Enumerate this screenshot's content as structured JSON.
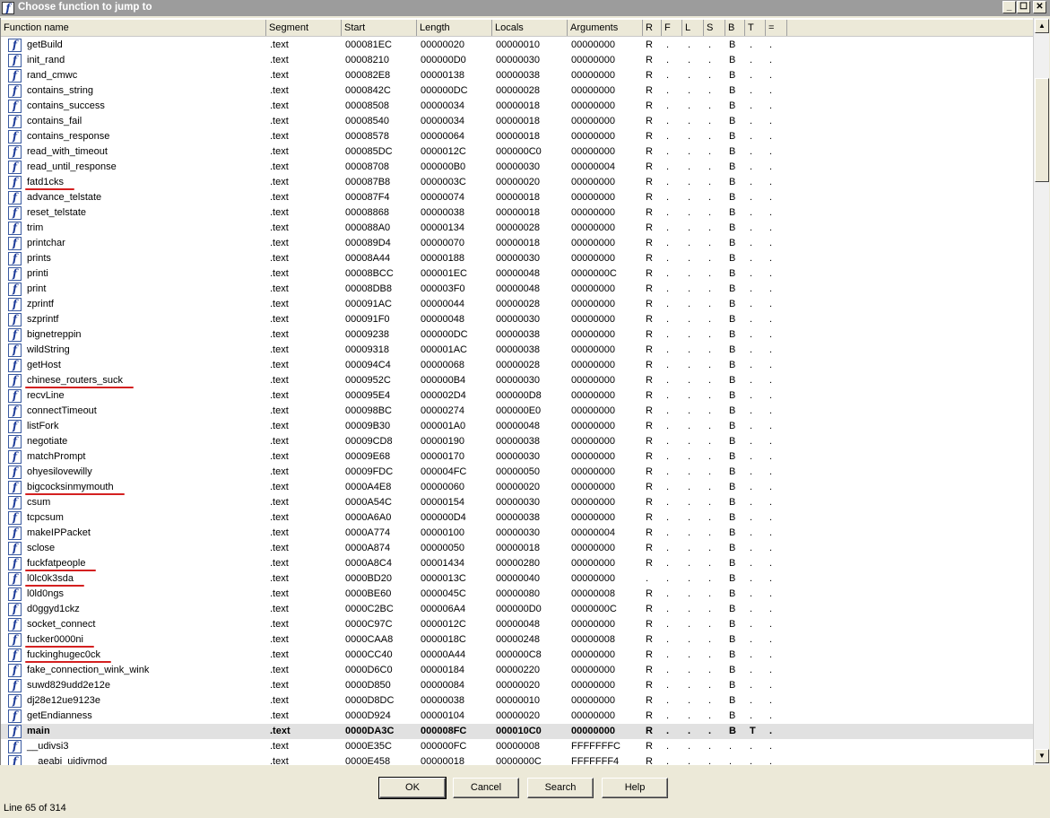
{
  "window": {
    "title": "Choose function to jump to",
    "icon": "function-icon",
    "controls": [
      "_",
      "☐",
      "✕"
    ]
  },
  "columns": [
    "Function name",
    "Segment",
    "Start",
    "Length",
    "Locals",
    "Arguments",
    "R",
    "F",
    "L",
    "S",
    "B",
    "T",
    "="
  ],
  "rows": [
    [
      "getBuild",
      ".text",
      "000081EC",
      "00000020",
      "00000010",
      "00000000",
      "R",
      ".",
      ".",
      ".",
      "B",
      ".",
      "."
    ],
    [
      "init_rand",
      ".text",
      "00008210",
      "000000D0",
      "00000030",
      "00000000",
      "R",
      ".",
      ".",
      ".",
      "B",
      ".",
      "."
    ],
    [
      "rand_cmwc",
      ".text",
      "000082E8",
      "00000138",
      "00000038",
      "00000000",
      "R",
      ".",
      ".",
      ".",
      "B",
      ".",
      "."
    ],
    [
      "contains_string",
      ".text",
      "0000842C",
      "000000DC",
      "00000028",
      "00000000",
      "R",
      ".",
      ".",
      ".",
      "B",
      ".",
      "."
    ],
    [
      "contains_success",
      ".text",
      "00008508",
      "00000034",
      "00000018",
      "00000000",
      "R",
      ".",
      ".",
      ".",
      "B",
      ".",
      "."
    ],
    [
      "contains_fail",
      ".text",
      "00008540",
      "00000034",
      "00000018",
      "00000000",
      "R",
      ".",
      ".",
      ".",
      "B",
      ".",
      "."
    ],
    [
      "contains_response",
      ".text",
      "00008578",
      "00000064",
      "00000018",
      "00000000",
      "R",
      ".",
      ".",
      ".",
      "B",
      ".",
      "."
    ],
    [
      "read_with_timeout",
      ".text",
      "000085DC",
      "0000012C",
      "000000C0",
      "00000000",
      "R",
      ".",
      ".",
      ".",
      "B",
      ".",
      "."
    ],
    [
      "read_until_response",
      ".text",
      "00008708",
      "000000B0",
      "00000030",
      "00000004",
      "R",
      ".",
      ".",
      ".",
      "B",
      ".",
      "."
    ],
    [
      "fatd1cks",
      ".text",
      "000087B8",
      "0000003C",
      "00000020",
      "00000000",
      "R",
      ".",
      ".",
      ".",
      "B",
      ".",
      "."
    ],
    [
      "advance_telstate",
      ".text",
      "000087F4",
      "00000074",
      "00000018",
      "00000000",
      "R",
      ".",
      ".",
      ".",
      "B",
      ".",
      "."
    ],
    [
      "reset_telstate",
      ".text",
      "00008868",
      "00000038",
      "00000018",
      "00000000",
      "R",
      ".",
      ".",
      ".",
      "B",
      ".",
      "."
    ],
    [
      "trim",
      ".text",
      "000088A0",
      "00000134",
      "00000028",
      "00000000",
      "R",
      ".",
      ".",
      ".",
      "B",
      ".",
      "."
    ],
    [
      "printchar",
      ".text",
      "000089D4",
      "00000070",
      "00000018",
      "00000000",
      "R",
      ".",
      ".",
      ".",
      "B",
      ".",
      "."
    ],
    [
      "prints",
      ".text",
      "00008A44",
      "00000188",
      "00000030",
      "00000000",
      "R",
      ".",
      ".",
      ".",
      "B",
      ".",
      "."
    ],
    [
      "printi",
      ".text",
      "00008BCC",
      "000001EC",
      "00000048",
      "0000000C",
      "R",
      ".",
      ".",
      ".",
      "B",
      ".",
      "."
    ],
    [
      "print",
      ".text",
      "00008DB8",
      "000003F0",
      "00000048",
      "00000000",
      "R",
      ".",
      ".",
      ".",
      "B",
      ".",
      "."
    ],
    [
      "zprintf",
      ".text",
      "000091AC",
      "00000044",
      "00000028",
      "00000000",
      "R",
      ".",
      ".",
      ".",
      "B",
      ".",
      "."
    ],
    [
      "szprintf",
      ".text",
      "000091F0",
      "00000048",
      "00000030",
      "00000000",
      "R",
      ".",
      ".",
      ".",
      "B",
      ".",
      "."
    ],
    [
      "bignetreppin",
      ".text",
      "00009238",
      "000000DC",
      "00000038",
      "00000000",
      "R",
      ".",
      ".",
      ".",
      "B",
      ".",
      "."
    ],
    [
      "wildString",
      ".text",
      "00009318",
      "000001AC",
      "00000038",
      "00000000",
      "R",
      ".",
      ".",
      ".",
      "B",
      ".",
      "."
    ],
    [
      "getHost",
      ".text",
      "000094C4",
      "00000068",
      "00000028",
      "00000000",
      "R",
      ".",
      ".",
      ".",
      "B",
      ".",
      "."
    ],
    [
      "chinese_routers_suck",
      ".text",
      "0000952C",
      "000000B4",
      "00000030",
      "00000000",
      "R",
      ".",
      ".",
      ".",
      "B",
      ".",
      "."
    ],
    [
      "recvLine",
      ".text",
      "000095E4",
      "000002D4",
      "000000D8",
      "00000000",
      "R",
      ".",
      ".",
      ".",
      "B",
      ".",
      "."
    ],
    [
      "connectTimeout",
      ".text",
      "000098BC",
      "00000274",
      "000000E0",
      "00000000",
      "R",
      ".",
      ".",
      ".",
      "B",
      ".",
      "."
    ],
    [
      "listFork",
      ".text",
      "00009B30",
      "000001A0",
      "00000048",
      "00000000",
      "R",
      ".",
      ".",
      ".",
      "B",
      ".",
      "."
    ],
    [
      "negotiate",
      ".text",
      "00009CD8",
      "00000190",
      "00000038",
      "00000000",
      "R",
      ".",
      ".",
      ".",
      "B",
      ".",
      "."
    ],
    [
      "matchPrompt",
      ".text",
      "00009E68",
      "00000170",
      "00000030",
      "00000000",
      "R",
      ".",
      ".",
      ".",
      "B",
      ".",
      "."
    ],
    [
      "ohyesilovewilly",
      ".text",
      "00009FDC",
      "000004FC",
      "00000050",
      "00000000",
      "R",
      ".",
      ".",
      ".",
      "B",
      ".",
      "."
    ],
    [
      "bigcocksinmymouth",
      ".text",
      "0000A4E8",
      "00000060",
      "00000020",
      "00000000",
      "R",
      ".",
      ".",
      ".",
      "B",
      ".",
      "."
    ],
    [
      "csum",
      ".text",
      "0000A54C",
      "00000154",
      "00000030",
      "00000000",
      "R",
      ".",
      ".",
      ".",
      "B",
      ".",
      "."
    ],
    [
      "tcpcsum",
      ".text",
      "0000A6A0",
      "000000D4",
      "00000038",
      "00000000",
      "R",
      ".",
      ".",
      ".",
      "B",
      ".",
      "."
    ],
    [
      "makeIPPacket",
      ".text",
      "0000A774",
      "00000100",
      "00000030",
      "00000004",
      "R",
      ".",
      ".",
      ".",
      "B",
      ".",
      "."
    ],
    [
      "sclose",
      ".text",
      "0000A874",
      "00000050",
      "00000018",
      "00000000",
      "R",
      ".",
      ".",
      ".",
      "B",
      ".",
      "."
    ],
    [
      "fuckfatpeople",
      ".text",
      "0000A8C4",
      "00001434",
      "00000280",
      "00000000",
      "R",
      ".",
      ".",
      ".",
      "B",
      ".",
      "."
    ],
    [
      "l0lc0k3sda",
      ".text",
      "0000BD20",
      "0000013C",
      "00000040",
      "00000000",
      ".",
      ".",
      ".",
      ".",
      "B",
      ".",
      "."
    ],
    [
      "l0ld0ngs",
      ".text",
      "0000BE60",
      "0000045C",
      "00000080",
      "00000008",
      "R",
      ".",
      ".",
      ".",
      "B",
      ".",
      "."
    ],
    [
      "d0ggyd1ckz",
      ".text",
      "0000C2BC",
      "000006A4",
      "000000D0",
      "0000000C",
      "R",
      ".",
      ".",
      ".",
      "B",
      ".",
      "."
    ],
    [
      "socket_connect",
      ".text",
      "0000C97C",
      "0000012C",
      "00000048",
      "00000000",
      "R",
      ".",
      ".",
      ".",
      "B",
      ".",
      "."
    ],
    [
      "fucker0000ni",
      ".text",
      "0000CAA8",
      "0000018C",
      "00000248",
      "00000008",
      "R",
      ".",
      ".",
      ".",
      "B",
      ".",
      "."
    ],
    [
      "fuckinghugec0ck",
      ".text",
      "0000CC40",
      "00000A44",
      "000000C8",
      "00000000",
      "R",
      ".",
      ".",
      ".",
      "B",
      ".",
      "."
    ],
    [
      "fake_connection_wink_wink",
      ".text",
      "0000D6C0",
      "00000184",
      "00000220",
      "00000000",
      "R",
      ".",
      ".",
      ".",
      "B",
      ".",
      "."
    ],
    [
      "suwd829udd2e12e",
      ".text",
      "0000D850",
      "00000084",
      "00000020",
      "00000000",
      "R",
      ".",
      ".",
      ".",
      "B",
      ".",
      "."
    ],
    [
      "dj28e12ue9123e",
      ".text",
      "0000D8DC",
      "00000038",
      "00000010",
      "00000000",
      "R",
      ".",
      ".",
      ".",
      "B",
      ".",
      "."
    ],
    [
      "getEndianness",
      ".text",
      "0000D924",
      "00000104",
      "00000020",
      "00000000",
      "R",
      ".",
      ".",
      ".",
      "B",
      ".",
      "."
    ],
    [
      "main",
      ".text",
      "0000DA3C",
      "000008FC",
      "000010C0",
      "00000000",
      "R",
      ".",
      ".",
      ".",
      "B",
      "T",
      "."
    ],
    [
      "__udivsi3",
      ".text",
      "0000E35C",
      "000000FC",
      "00000008",
      "FFFFFFFC",
      "R",
      ".",
      ".",
      ".",
      ".",
      ".",
      "."
    ],
    [
      "__aeabi_uidivmod",
      ".text",
      "0000E458",
      "00000018",
      "0000000C",
      "FFFFFFF4",
      "R",
      ".",
      ".",
      ".",
      ".",
      ".",
      "."
    ]
  ],
  "selected_row": 45,
  "buttons": {
    "ok": "OK",
    "cancel": "Cancel",
    "search": "Search",
    "help": "Help"
  },
  "status": "Line 65 of 314",
  "highlight_color": "#d42020",
  "underlined_functions": [
    "fatd1cks",
    "chinese_routers_suck",
    "bigcocksinmymouth",
    "fuckfatpeople",
    "l0lc0k3sda",
    "fucker0000ni",
    "fuckinghugec0ck"
  ]
}
